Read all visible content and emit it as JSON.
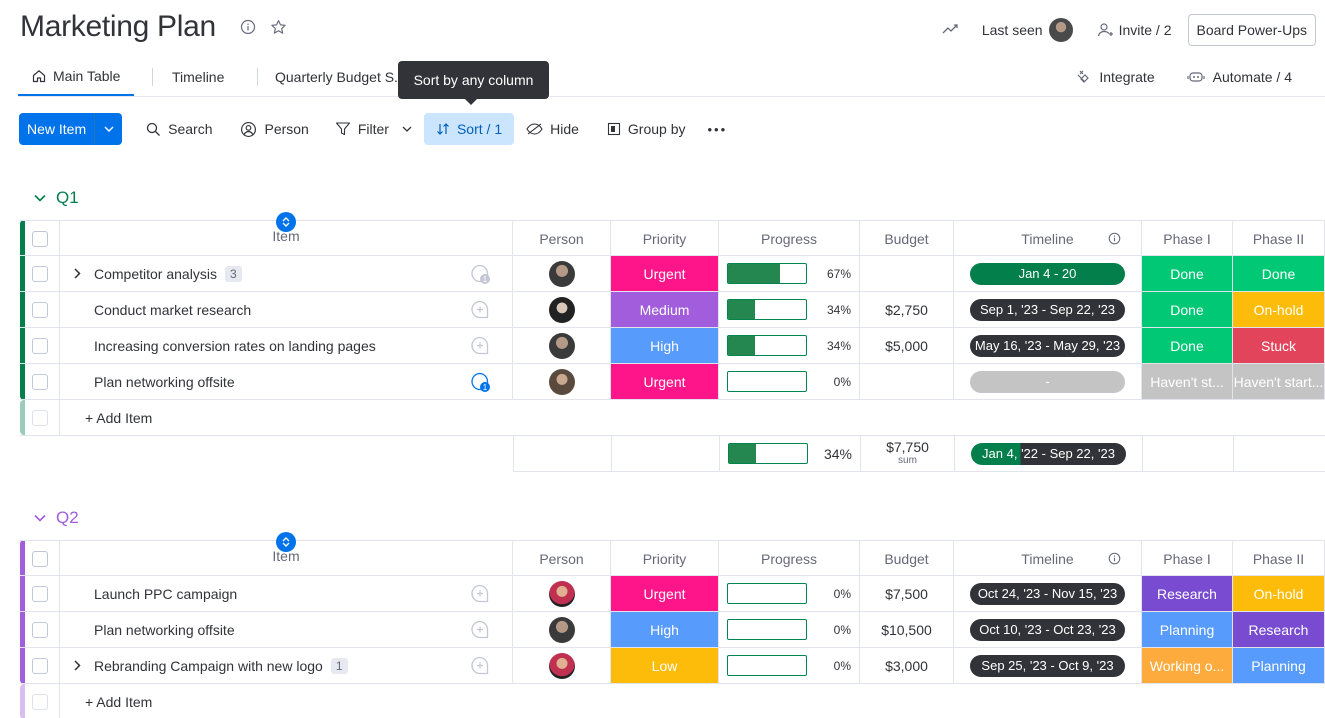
{
  "header": {
    "title": "Marketing Plan",
    "last_seen": "Last seen",
    "invite": "Invite / 2",
    "power_ups": "Board Power-Ups"
  },
  "tabs": [
    {
      "label": "Main Table",
      "active": true
    },
    {
      "label": "Timeline",
      "active": false
    },
    {
      "label": "Quarterly Budget S...",
      "active": false
    }
  ],
  "tabs_right": {
    "integrate": "Integrate",
    "automate": "Automate / 4"
  },
  "tooltip": "Sort by any column",
  "toolbar": {
    "new_item": "New Item",
    "search": "Search",
    "person": "Person",
    "filter": "Filter",
    "sort": "Sort / 1",
    "hide": "Hide",
    "group_by": "Group by",
    "more": "•••"
  },
  "columns": {
    "item": "Item",
    "person": "Person",
    "priority": "Priority",
    "progress": "Progress",
    "budget": "Budget",
    "timeline": "Timeline",
    "phase1": "Phase I",
    "phase2": "Phase II"
  },
  "colors": {
    "urgent": "#e2445c",
    "urgent_pink": "#ff158a",
    "medium": "#a25ddc",
    "high": "#579bfc",
    "low": "#fdbc09",
    "done": "#00c875",
    "onhold": "#fdbc09",
    "stuck": "#e2445c",
    "gray": "#c4c4c4",
    "research": "#784bd1",
    "planning": "#579bfc",
    "working": "#fdab3d",
    "q1": "#037f4c",
    "q2": "#a25ddc",
    "pill_dark": "#323338",
    "pill_green": "#037f4c"
  },
  "groups": [
    {
      "title": "Q1",
      "color": "#037f4c",
      "rows": [
        {
          "name": "Competitor analysis",
          "subitems": "3",
          "expandable": true,
          "priority": "Urgent",
          "priority_color": "#ff158a",
          "progress": 67,
          "progress_label": "67%",
          "budget": "",
          "timeline": "Jan 4 - 20",
          "timeline_color": "#037f4c",
          "phase1": "Done",
          "phase1_color": "#00c875",
          "phase2": "Done",
          "phase2_color": "#00c875",
          "update_active": false,
          "avatar": "a"
        },
        {
          "name": "Conduct market research",
          "subitems": "",
          "expandable": false,
          "priority": "Medium",
          "priority_color": "#a25ddc",
          "progress": 34,
          "progress_label": "34%",
          "budget": "$2,750",
          "timeline": "Sep 1, '23 - Sep 22, '23",
          "timeline_color": "#323338",
          "phase1": "Done",
          "phase1_color": "#00c875",
          "phase2": "On-hold",
          "phase2_color": "#fdbc09",
          "update_active": false,
          "avatar": "b"
        },
        {
          "name": "Increasing conversion rates on landing pages",
          "subitems": "",
          "expandable": false,
          "priority": "High",
          "priority_color": "#579bfc",
          "progress": 34,
          "progress_label": "34%",
          "budget": "$5,000",
          "timeline": "May 16, '23 - May 29, '23",
          "timeline_color": "#323338",
          "phase1": "Done",
          "phase1_color": "#00c875",
          "phase2": "Stuck",
          "phase2_color": "#e2445c",
          "update_active": false,
          "avatar": "a"
        },
        {
          "name": "Plan networking offsite",
          "subitems": "",
          "expandable": false,
          "priority": "Urgent",
          "priority_color": "#ff158a",
          "progress": 0,
          "progress_label": "0%",
          "budget": "",
          "timeline": "-",
          "timeline_color": "#c4c4c4",
          "phase1": "Haven't st...",
          "phase1_color": "#c4c4c4",
          "phase2": "Haven't start...",
          "phase2_color": "#c4c4c4",
          "update_active": true,
          "avatar": "c"
        }
      ],
      "add_item": "+ Add Item",
      "summary": {
        "progress": 34,
        "progress_label": "34%",
        "budget": "$7,750",
        "budget_sub": "sum",
        "timeline": "Jan 4, '22 - Sep 22, '23"
      }
    },
    {
      "title": "Q2",
      "color": "#a25ddc",
      "rows": [
        {
          "name": "Launch PPC campaign",
          "subitems": "",
          "expandable": false,
          "priority": "Urgent",
          "priority_color": "#ff158a",
          "progress": 0,
          "progress_label": "0%",
          "budget": "$7,500",
          "timeline": "Oct 24, '23 - Nov 15, '23",
          "timeline_color": "#323338",
          "phase1": "Research",
          "phase1_color": "#784bd1",
          "phase2": "On-hold",
          "phase2_color": "#fdbc09",
          "update_active": false,
          "avatar": "d"
        },
        {
          "name": "Plan networking offsite",
          "subitems": "",
          "expandable": false,
          "priority": "High",
          "priority_color": "#579bfc",
          "progress": 0,
          "progress_label": "0%",
          "budget": "$10,500",
          "timeline": "Oct 10, '23 - Oct 23, '23",
          "timeline_color": "#323338",
          "phase1": "Planning",
          "phase1_color": "#579bfc",
          "phase2": "Research",
          "phase2_color": "#784bd1",
          "update_active": false,
          "avatar": "a"
        },
        {
          "name": "Rebranding Campaign with new logo",
          "subitems": "1",
          "expandable": true,
          "priority": "Low",
          "priority_color": "#fdbc09",
          "progress": 0,
          "progress_label": "0%",
          "budget": "$3,000",
          "timeline": "Sep 25, '23 - Oct 9, '23",
          "timeline_color": "#323338",
          "phase1": "Working o...",
          "phase1_color": "#fdab3d",
          "phase2": "Planning",
          "phase2_color": "#579bfc",
          "update_active": false,
          "avatar": "d"
        }
      ],
      "add_item": "+ Add Item"
    }
  ]
}
